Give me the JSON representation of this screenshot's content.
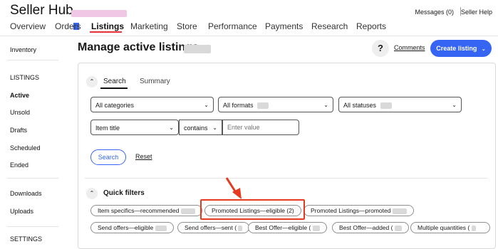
{
  "header": {
    "title": "Seller Hub",
    "messages": "Messages (0)",
    "help": "Seller Help",
    "nav": [
      "Overview",
      "Orders",
      "Listings",
      "Marketing",
      "Store",
      "Performance",
      "Payments",
      "Research",
      "Reports"
    ],
    "active_nav": "Listings",
    "accent": "#e53238"
  },
  "sidebar": {
    "items": [
      "Inventory",
      "LISTINGS",
      "Active",
      "Unsold",
      "Drafts",
      "Scheduled",
      "Ended",
      "Downloads",
      "Uploads",
      "SETTINGS"
    ]
  },
  "main": {
    "page_title": "Manage active listings",
    "help_label": "?",
    "comments": "Comments",
    "create_listing": "Create listing",
    "brand_color": "#3665f3",
    "tabs": [
      "Search",
      "Summary"
    ],
    "filters": {
      "category": "All categories",
      "format": "All formats",
      "status": "All statuses",
      "field": "Item title",
      "operator": "contains",
      "value_placeholder": "Enter value"
    },
    "search_button": "Search",
    "reset": "Reset",
    "quick_filters_label": "Quick filters",
    "chips": [
      "Item specifics—recommended",
      "Promoted Listings—eligible (2)",
      "Promoted Listings—promoted",
      "Send offers—eligible",
      "Send offers—sent (",
      "Best Offer—eligible (",
      "Best Offer—added (",
      "Multiple quantities ("
    ],
    "highlight_color": "#e53a1f"
  }
}
